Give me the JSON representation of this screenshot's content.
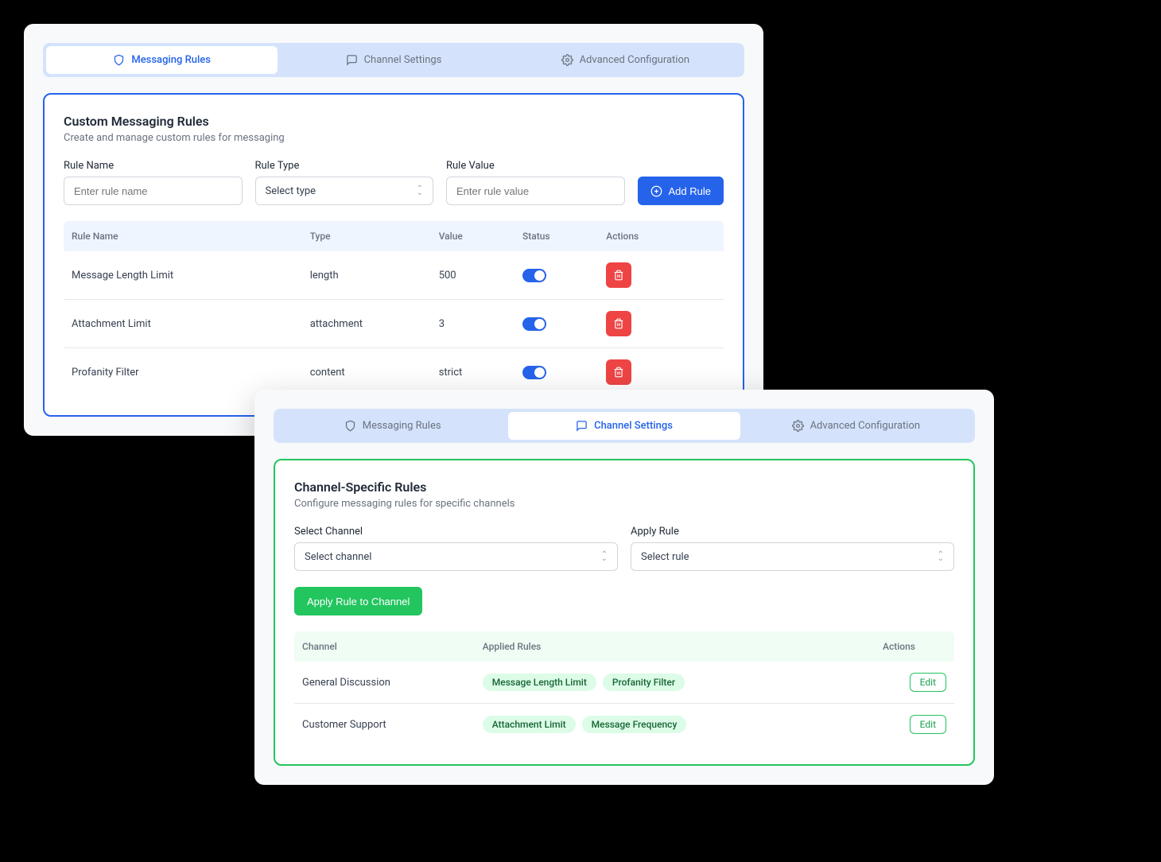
{
  "tabs": [
    {
      "label": "Messaging Rules"
    },
    {
      "label": "Channel Settings"
    },
    {
      "label": "Advanced Configuration"
    }
  ],
  "panel1": {
    "title": "Custom Messaging Rules",
    "subtitle": "Create and manage custom rules for messaging",
    "form": {
      "ruleName": {
        "label": "Rule Name",
        "placeholder": "Enter rule name"
      },
      "ruleType": {
        "label": "Rule Type",
        "placeholder": "Select type"
      },
      "ruleValue": {
        "label": "Rule Value",
        "placeholder": "Enter rule value"
      },
      "addButton": "Add Rule"
    },
    "headers": {
      "name": "Rule Name",
      "type": "Type",
      "value": "Value",
      "status": "Status",
      "actions": "Actions"
    },
    "rows": [
      {
        "name": "Message Length Limit",
        "type": "length",
        "value": "500"
      },
      {
        "name": "Attachment Limit",
        "type": "attachment",
        "value": "3"
      },
      {
        "name": "Profanity Filter",
        "type": "content",
        "value": "strict"
      }
    ]
  },
  "panel2": {
    "title": "Channel-Specific Rules",
    "subtitle": "Configure messaging rules for specific channels",
    "form": {
      "selectChannel": {
        "label": "Select Channel",
        "placeholder": "Select channel"
      },
      "applyRule": {
        "label": "Apply Rule",
        "placeholder": "Select rule"
      },
      "applyButton": "Apply Rule to Channel"
    },
    "headers": {
      "channel": "Channel",
      "rules": "Applied Rules",
      "actions": "Actions"
    },
    "rows": [
      {
        "channel": "General Discussion",
        "rules": [
          "Message Length Limit",
          "Profanity Filter"
        ],
        "edit": "Edit"
      },
      {
        "channel": "Customer Support",
        "rules": [
          "Attachment Limit",
          "Message Frequency"
        ],
        "edit": "Edit"
      }
    ]
  }
}
